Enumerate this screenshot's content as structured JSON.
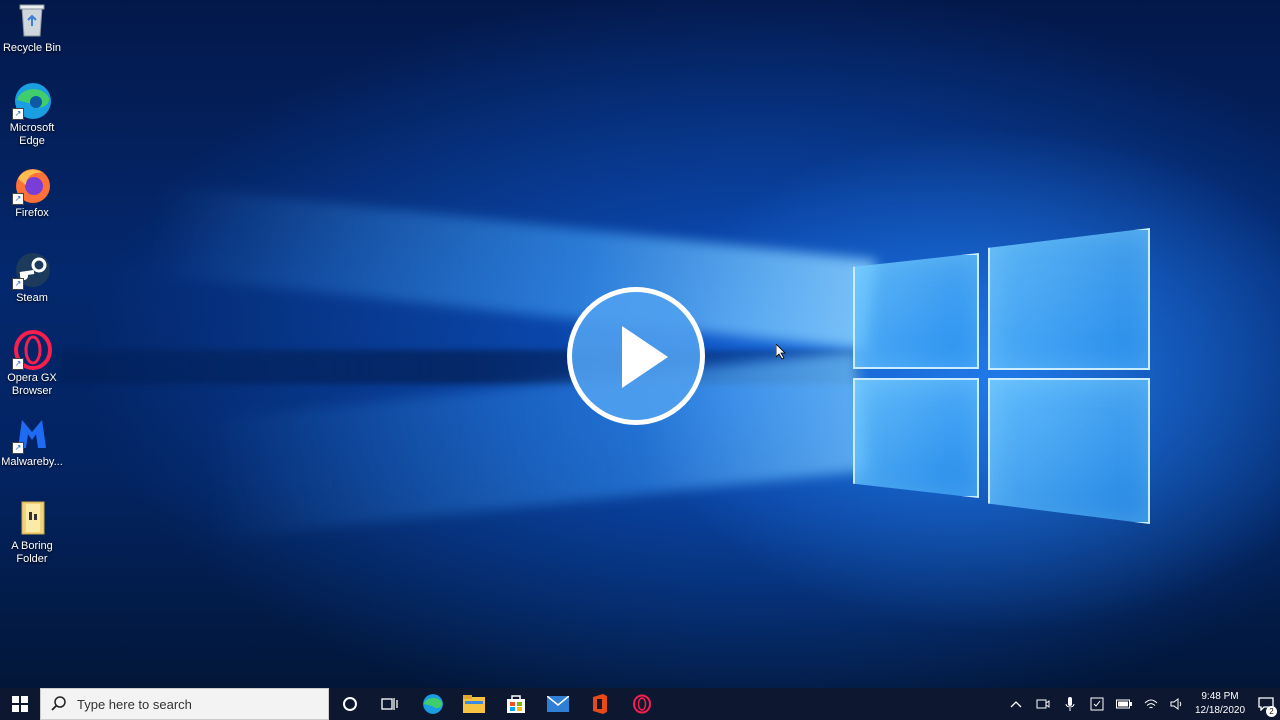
{
  "desktop_icons": [
    {
      "label": "Recycle Bin",
      "icon": "recycle-bin-icon"
    },
    {
      "label": "Microsoft Edge",
      "icon": "edge-icon"
    },
    {
      "label": "Firefox",
      "icon": "firefox-icon"
    },
    {
      "label": "Steam",
      "icon": "steam-icon"
    },
    {
      "label": "Opera GX Browser",
      "icon": "opera-gx-icon"
    },
    {
      "label": "Malwareby...",
      "icon": "malwarebytes-icon"
    },
    {
      "label": "A Boring Folder",
      "icon": "folder-icon"
    }
  ],
  "taskbar": {
    "search_placeholder": "Type here to search",
    "pinned": [
      "cortana-icon",
      "task-view-icon",
      "edge-icon",
      "file-explorer-icon",
      "store-icon",
      "mail-icon",
      "office-icon",
      "opera-gx-icon"
    ],
    "tray": {
      "time": "9:48 PM",
      "date": "12/18/2020",
      "notification_count": "2"
    }
  },
  "colors": {
    "taskbar": "#0d1730",
    "play_button": "#50a0f0",
    "wallpaper_accent": "#2e8cff"
  }
}
